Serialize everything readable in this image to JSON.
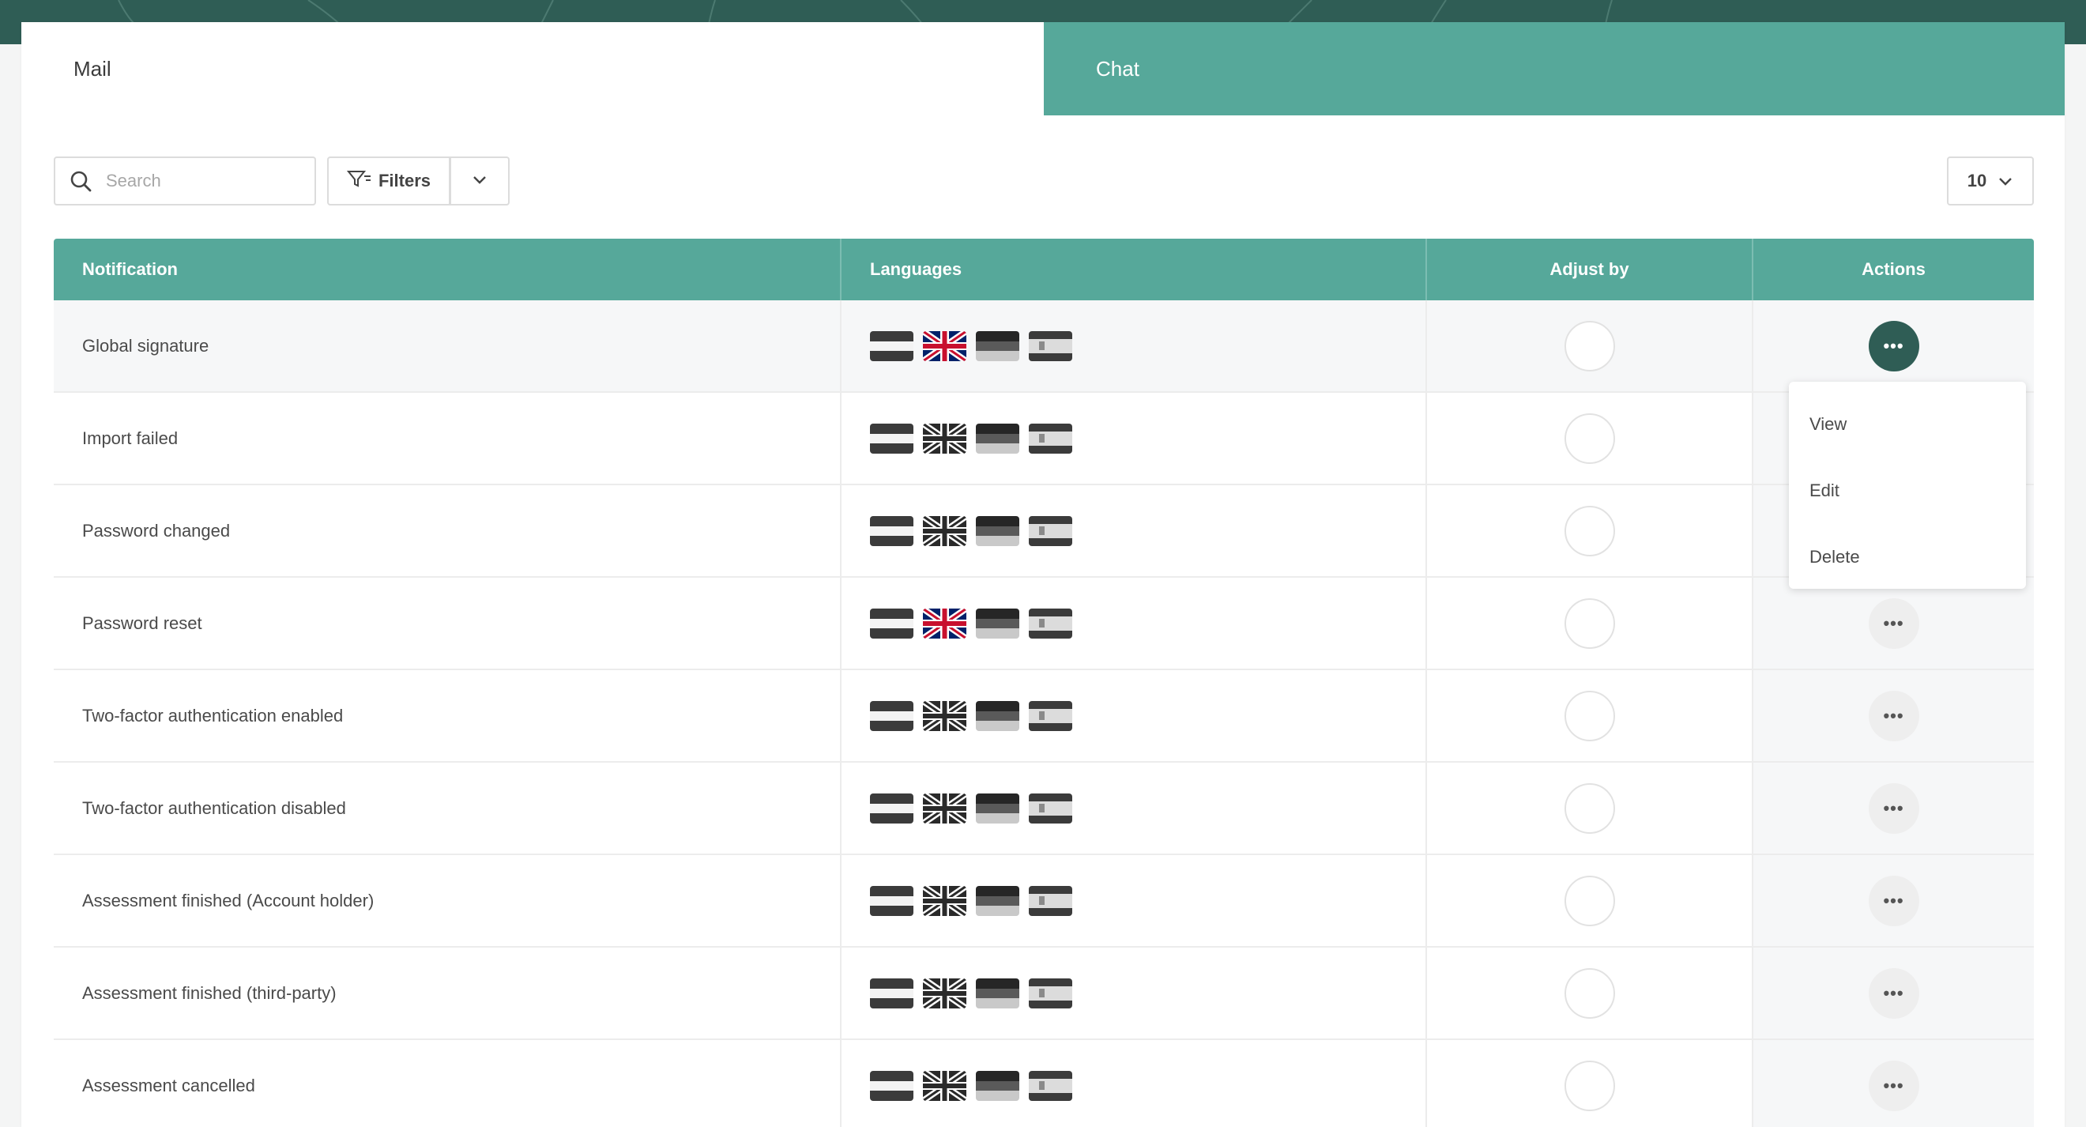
{
  "tabs": {
    "mail": "Mail",
    "chat": "Chat"
  },
  "toolbar": {
    "search_placeholder": "Search",
    "filters_label": "Filters",
    "per_page": "10"
  },
  "table": {
    "headers": {
      "notification": "Notification",
      "languages": "Languages",
      "adjust_by": "Adjust by",
      "actions": "Actions"
    },
    "rows": [
      {
        "notification": "Global signature",
        "en_active": true
      },
      {
        "notification": "Import failed",
        "en_active": false
      },
      {
        "notification": "Password changed",
        "en_active": false
      },
      {
        "notification": "Password reset",
        "en_active": true
      },
      {
        "notification": "Two-factor authentication enabled",
        "en_active": false
      },
      {
        "notification": "Two-factor authentication disabled",
        "en_active": false
      },
      {
        "notification": "Assessment finished (Account holder)",
        "en_active": false
      },
      {
        "notification": "Assessment finished (third-party)",
        "en_active": false
      },
      {
        "notification": "Assessment cancelled",
        "en_active": false
      }
    ]
  },
  "action_menu": {
    "view": "View",
    "edit": "Edit",
    "delete": "Delete"
  },
  "colors": {
    "accent": "#56a89a",
    "dark_green": "#2f5d55",
    "uk_red": "#c8102e",
    "uk_blue": "#012169"
  },
  "icons": {
    "search": "search-icon",
    "filter": "filter-icon",
    "chevron": "chevron-down-icon",
    "more": "more-icon"
  }
}
